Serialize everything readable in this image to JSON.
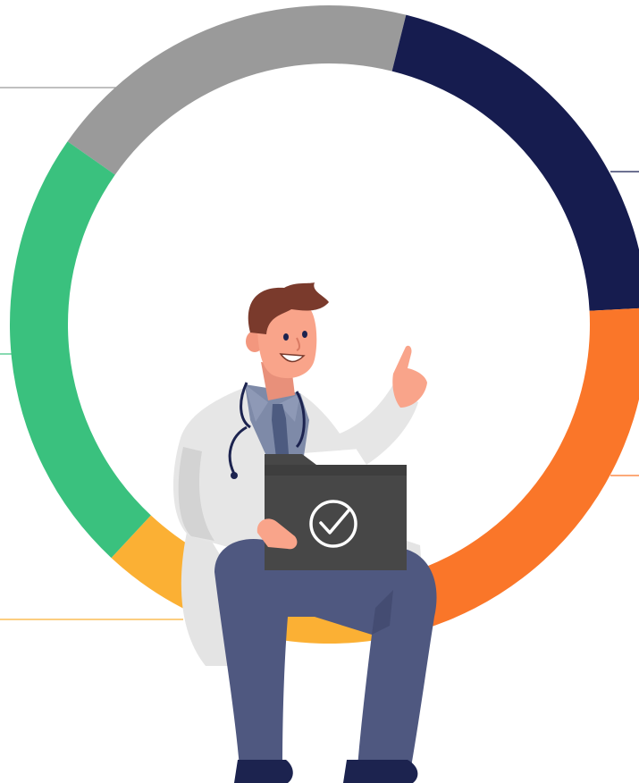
{
  "illustration": {
    "ring_segments": [
      {
        "name": "gray",
        "color": "#9A9A9A"
      },
      {
        "name": "navy",
        "color": "#161C4F"
      },
      {
        "name": "orange",
        "color": "#FA7629"
      },
      {
        "name": "yellow",
        "color": "#FBB034"
      },
      {
        "name": "green",
        "color": "#3AC17E"
      }
    ],
    "connector_line_colors": {
      "gray": "#9A9A9A",
      "navy": "#161C4F",
      "orange": "#FA7629",
      "yellow": "#FBB034",
      "green": "#3AC17E"
    },
    "character": {
      "role": "doctor",
      "icons": [
        "stethoscope-icon",
        "folder-icon",
        "check-circle-icon"
      ],
      "colors": {
        "hair": "#7A3A2C",
        "skin": "#F9A48A",
        "coat": "#E6E6E6",
        "shirt": "#7E8AA8",
        "tie": "#4D5B80",
        "trousers": "#4F5880",
        "shoes": "#1C234F",
        "folder": "#474747"
      }
    }
  }
}
